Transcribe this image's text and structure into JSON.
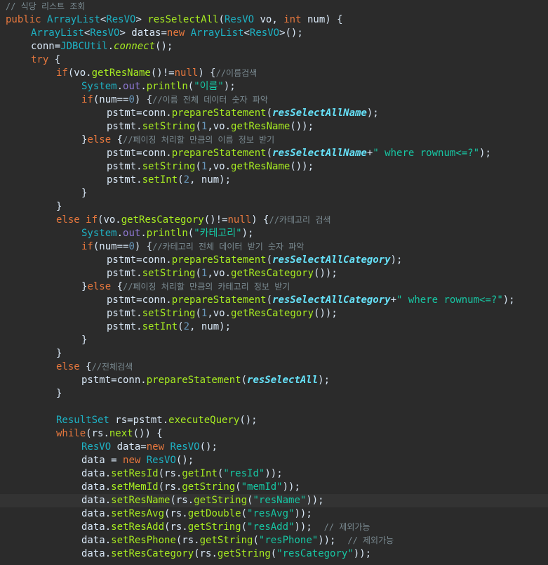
{
  "window": {
    "background": "#2b2b2b",
    "current_line_index": 37
  },
  "colors": {
    "comment": "#7a8a91",
    "keyword": "#e6773d",
    "type": "#1eb2c4",
    "plain": "#d9e8f7",
    "method": "#a7ec21",
    "string": "#17c6a3",
    "number": "#6897bb",
    "static_field": "#8d77d1",
    "field_constant": "#66e1f8",
    "current_line": "#333333"
  },
  "editor": {
    "lines": [
      {
        "indent": 0,
        "tokens": [
          [
            "cm",
            "// 식당 리스트 조회"
          ]
        ]
      },
      {
        "indent": 0,
        "tokens": [
          [
            "kw",
            "public "
          ],
          [
            "ty",
            "ArrayList"
          ],
          [
            "pl",
            "<"
          ],
          [
            "ty",
            "ResVO"
          ],
          [
            "pl",
            "> "
          ],
          [
            "mt",
            "resSelectAll"
          ],
          [
            "pl",
            "("
          ],
          [
            "ty",
            "ResVO"
          ],
          [
            "pl",
            " vo, "
          ],
          [
            "kw",
            "int"
          ],
          [
            "pl",
            " num) {"
          ]
        ]
      },
      {
        "indent": 1,
        "tokens": [
          [
            "ty",
            "ArrayList"
          ],
          [
            "pl",
            "<"
          ],
          [
            "ty",
            "ResVO"
          ],
          [
            "pl",
            "> datas="
          ],
          [
            "kw",
            "new "
          ],
          [
            "ty",
            "ArrayList"
          ],
          [
            "pl",
            "<"
          ],
          [
            "ty",
            "ResVO"
          ],
          [
            "pl",
            ">();"
          ]
        ]
      },
      {
        "indent": 1,
        "tokens": [
          [
            "pl",
            "conn="
          ],
          [
            "ty",
            "JDBCUtil"
          ],
          [
            "pl",
            "."
          ],
          [
            "ut",
            "connect"
          ],
          [
            "pl",
            "();"
          ]
        ]
      },
      {
        "indent": 1,
        "tokens": [
          [
            "kw",
            "try"
          ],
          [
            "pl",
            " {"
          ]
        ]
      },
      {
        "indent": 2,
        "tokens": [
          [
            "kw",
            "if"
          ],
          [
            "pl",
            "(vo."
          ],
          [
            "mt",
            "getResName"
          ],
          [
            "pl",
            "()!="
          ],
          [
            "kw",
            "null"
          ],
          [
            "pl",
            ") {"
          ],
          [
            "cm",
            "//이름검색"
          ]
        ]
      },
      {
        "indent": 3,
        "tokens": [
          [
            "ty",
            "System"
          ],
          [
            "pl",
            "."
          ],
          [
            "sf",
            "out"
          ],
          [
            "pl",
            "."
          ],
          [
            "mt",
            "println"
          ],
          [
            "pl",
            "("
          ],
          [
            "st",
            "\"이름\""
          ],
          [
            "pl",
            ");"
          ]
        ]
      },
      {
        "indent": 3,
        "tokens": [
          [
            "kw",
            "if"
          ],
          [
            "pl",
            "(num=="
          ],
          [
            "nu",
            "0"
          ],
          [
            "pl",
            ") {"
          ],
          [
            "cm",
            "//이름 전체 데이터 숫자 파악"
          ]
        ]
      },
      {
        "indent": 4,
        "tokens": [
          [
            "pl",
            "pstmt=conn."
          ],
          [
            "mt",
            "prepareStatement"
          ],
          [
            "pl",
            "("
          ],
          [
            "fi",
            "resSelectAllName"
          ],
          [
            "pl",
            ");"
          ]
        ]
      },
      {
        "indent": 4,
        "tokens": [
          [
            "pl",
            "pstmt."
          ],
          [
            "mt",
            "setString"
          ],
          [
            "pl",
            "("
          ],
          [
            "nu",
            "1"
          ],
          [
            "pl",
            ",vo."
          ],
          [
            "mt",
            "getResName"
          ],
          [
            "pl",
            "());"
          ]
        ]
      },
      {
        "indent": 3,
        "tokens": [
          [
            "pl",
            "}"
          ],
          [
            "kw",
            "else"
          ],
          [
            "pl",
            " {"
          ],
          [
            "cm",
            "//페이징 처리할 만큼의 이름 정보 받기"
          ]
        ]
      },
      {
        "indent": 4,
        "tokens": [
          [
            "pl",
            "pstmt=conn."
          ],
          [
            "mt",
            "prepareStatement"
          ],
          [
            "pl",
            "("
          ],
          [
            "fi",
            "resSelectAllName"
          ],
          [
            "pl",
            "+"
          ],
          [
            "st",
            "\" where rownum<=?\""
          ],
          [
            "pl",
            ");"
          ]
        ]
      },
      {
        "indent": 4,
        "tokens": [
          [
            "pl",
            "pstmt."
          ],
          [
            "mt",
            "setString"
          ],
          [
            "pl",
            "("
          ],
          [
            "nu",
            "1"
          ],
          [
            "pl",
            ",vo."
          ],
          [
            "mt",
            "getResName"
          ],
          [
            "pl",
            "());"
          ]
        ]
      },
      {
        "indent": 4,
        "tokens": [
          [
            "pl",
            "pstmt."
          ],
          [
            "mt",
            "setInt"
          ],
          [
            "pl",
            "("
          ],
          [
            "nu",
            "2"
          ],
          [
            "pl",
            ", num);"
          ]
        ]
      },
      {
        "indent": 3,
        "tokens": [
          [
            "pl",
            "}"
          ]
        ]
      },
      {
        "indent": 2,
        "tokens": [
          [
            "pl",
            "}"
          ]
        ]
      },
      {
        "indent": 2,
        "tokens": [
          [
            "kw",
            "else if"
          ],
          [
            "pl",
            "(vo."
          ],
          [
            "mt",
            "getResCategory"
          ],
          [
            "pl",
            "()!="
          ],
          [
            "kw",
            "null"
          ],
          [
            "pl",
            ") {"
          ],
          [
            "cm",
            "//카테고리 검색"
          ]
        ]
      },
      {
        "indent": 3,
        "tokens": [
          [
            "ty",
            "System"
          ],
          [
            "pl",
            "."
          ],
          [
            "sf",
            "out"
          ],
          [
            "pl",
            "."
          ],
          [
            "mt",
            "println"
          ],
          [
            "pl",
            "("
          ],
          [
            "st",
            "\"카테고리\""
          ],
          [
            "pl",
            ");"
          ]
        ]
      },
      {
        "indent": 3,
        "tokens": [
          [
            "kw",
            "if"
          ],
          [
            "pl",
            "(num=="
          ],
          [
            "nu",
            "0"
          ],
          [
            "pl",
            ") {"
          ],
          [
            "cm",
            "//카테고리 전체 데이터 받기 숫자 파악"
          ]
        ]
      },
      {
        "indent": 4,
        "tokens": [
          [
            "pl",
            "pstmt=conn."
          ],
          [
            "mt",
            "prepareStatement"
          ],
          [
            "pl",
            "("
          ],
          [
            "fi",
            "resSelectAllCategory"
          ],
          [
            "pl",
            ");"
          ]
        ]
      },
      {
        "indent": 4,
        "tokens": [
          [
            "pl",
            "pstmt."
          ],
          [
            "mt",
            "setString"
          ],
          [
            "pl",
            "("
          ],
          [
            "nu",
            "1"
          ],
          [
            "pl",
            ",vo."
          ],
          [
            "mt",
            "getResCategory"
          ],
          [
            "pl",
            "());"
          ]
        ]
      },
      {
        "indent": 3,
        "tokens": [
          [
            "pl",
            "}"
          ],
          [
            "kw",
            "else"
          ],
          [
            "pl",
            " {"
          ],
          [
            "cm",
            "//페이징 처리할 만큼의 카테고리 정보 받기"
          ]
        ]
      },
      {
        "indent": 4,
        "tokens": [
          [
            "pl",
            "pstmt=conn."
          ],
          [
            "mt",
            "prepareStatement"
          ],
          [
            "pl",
            "("
          ],
          [
            "fi",
            "resSelectAllCategory"
          ],
          [
            "pl",
            "+"
          ],
          [
            "st",
            "\" where rownum<=?\""
          ],
          [
            "pl",
            ");"
          ]
        ]
      },
      {
        "indent": 4,
        "tokens": [
          [
            "pl",
            "pstmt."
          ],
          [
            "mt",
            "setString"
          ],
          [
            "pl",
            "("
          ],
          [
            "nu",
            "1"
          ],
          [
            "pl",
            ",vo."
          ],
          [
            "mt",
            "getResCategory"
          ],
          [
            "pl",
            "());"
          ]
        ]
      },
      {
        "indent": 4,
        "tokens": [
          [
            "pl",
            "pstmt."
          ],
          [
            "mt",
            "setInt"
          ],
          [
            "pl",
            "("
          ],
          [
            "nu",
            "2"
          ],
          [
            "pl",
            ", num);"
          ]
        ]
      },
      {
        "indent": 3,
        "tokens": [
          [
            "pl",
            "}"
          ]
        ]
      },
      {
        "indent": 2,
        "tokens": [
          [
            "pl",
            "}"
          ]
        ]
      },
      {
        "indent": 2,
        "tokens": [
          [
            "kw",
            "else"
          ],
          [
            "pl",
            " {"
          ],
          [
            "cm",
            "//전체검색"
          ]
        ]
      },
      {
        "indent": 3,
        "tokens": [
          [
            "pl",
            "pstmt=conn."
          ],
          [
            "mt",
            "prepareStatement"
          ],
          [
            "pl",
            "("
          ],
          [
            "fi",
            "resSelectAll"
          ],
          [
            "pl",
            ");"
          ]
        ]
      },
      {
        "indent": 2,
        "tokens": [
          [
            "pl",
            "}"
          ]
        ]
      },
      {
        "indent": 0,
        "tokens": []
      },
      {
        "indent": 2,
        "tokens": [
          [
            "ty",
            "ResultSet"
          ],
          [
            "pl",
            " rs=pstmt."
          ],
          [
            "mt",
            "executeQuery"
          ],
          [
            "pl",
            "();"
          ]
        ]
      },
      {
        "indent": 2,
        "tokens": [
          [
            "kw",
            "while"
          ],
          [
            "pl",
            "(rs."
          ],
          [
            "mt",
            "next"
          ],
          [
            "pl",
            "()) {"
          ]
        ]
      },
      {
        "indent": 3,
        "tokens": [
          [
            "ty",
            "ResVO"
          ],
          [
            "pl",
            " data="
          ],
          [
            "kw",
            "new "
          ],
          [
            "ty",
            "ResVO"
          ],
          [
            "pl",
            "();"
          ]
        ]
      },
      {
        "indent": 3,
        "tokens": [
          [
            "pl",
            "data = "
          ],
          [
            "kw",
            "new "
          ],
          [
            "ty",
            "ResVO"
          ],
          [
            "pl",
            "();"
          ]
        ]
      },
      {
        "indent": 3,
        "tokens": [
          [
            "pl",
            "data."
          ],
          [
            "mt",
            "setResId"
          ],
          [
            "pl",
            "(rs."
          ],
          [
            "mt",
            "getInt"
          ],
          [
            "pl",
            "("
          ],
          [
            "st",
            "\"resId\""
          ],
          [
            "pl",
            "));"
          ]
        ]
      },
      {
        "indent": 3,
        "tokens": [
          [
            "pl",
            "data."
          ],
          [
            "mt",
            "setMemId"
          ],
          [
            "pl",
            "(rs."
          ],
          [
            "mt",
            "getString"
          ],
          [
            "pl",
            "("
          ],
          [
            "st",
            "\"memId\""
          ],
          [
            "pl",
            "));"
          ]
        ]
      },
      {
        "indent": 3,
        "tokens": [
          [
            "pl",
            "data."
          ],
          [
            "mt",
            "setResName"
          ],
          [
            "pl",
            "(rs."
          ],
          [
            "mt",
            "getString"
          ],
          [
            "pl",
            "("
          ],
          [
            "st",
            "\"resName\""
          ],
          [
            "pl",
            "));"
          ]
        ]
      },
      {
        "indent": 3,
        "tokens": [
          [
            "pl",
            "data."
          ],
          [
            "mt",
            "setResAvg"
          ],
          [
            "pl",
            "(rs."
          ],
          [
            "mt",
            "getDouble"
          ],
          [
            "pl",
            "("
          ],
          [
            "st",
            "\"resAvg\""
          ],
          [
            "pl",
            "));"
          ]
        ]
      },
      {
        "indent": 3,
        "tokens": [
          [
            "pl",
            "data."
          ],
          [
            "mt",
            "setResAdd"
          ],
          [
            "pl",
            "(rs."
          ],
          [
            "mt",
            "getString"
          ],
          [
            "pl",
            "("
          ],
          [
            "st",
            "\"resAdd\""
          ],
          [
            "pl",
            "));  "
          ],
          [
            "cm",
            "// 제외가능"
          ]
        ]
      },
      {
        "indent": 3,
        "tokens": [
          [
            "pl",
            "data."
          ],
          [
            "mt",
            "setResPhone"
          ],
          [
            "pl",
            "(rs."
          ],
          [
            "mt",
            "getString"
          ],
          [
            "pl",
            "("
          ],
          [
            "st",
            "\"resPhone\""
          ],
          [
            "pl",
            "));  "
          ],
          [
            "cm",
            "// 제외가능"
          ]
        ]
      },
      {
        "indent": 3,
        "tokens": [
          [
            "pl",
            "data."
          ],
          [
            "mt",
            "setResCategory"
          ],
          [
            "pl",
            "(rs."
          ],
          [
            "mt",
            "getString"
          ],
          [
            "pl",
            "("
          ],
          [
            "st",
            "\"resCategory\""
          ],
          [
            "pl",
            "));"
          ]
        ]
      }
    ]
  }
}
